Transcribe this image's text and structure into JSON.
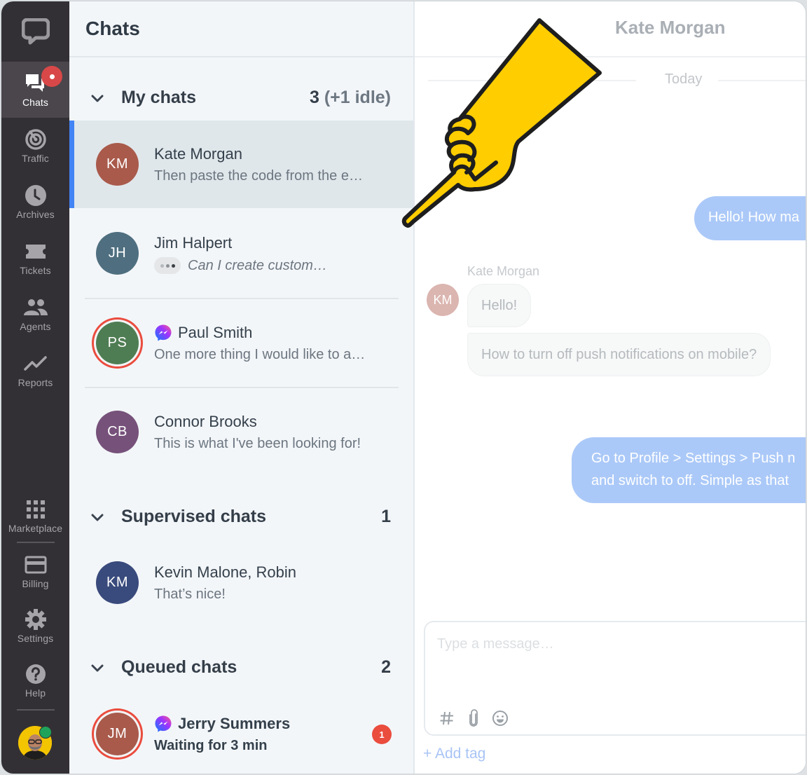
{
  "nav": {
    "logo_icon": "livechat-logo-icon",
    "items": [
      {
        "id": "chats",
        "label": "Chats",
        "icon": "chat-bubbles-icon",
        "active": true,
        "has_badge": true
      },
      {
        "id": "traffic",
        "label": "Traffic",
        "icon": "radar-icon"
      },
      {
        "id": "archives",
        "label": "Archives",
        "icon": "clock-icon"
      },
      {
        "id": "tickets",
        "label": "Tickets",
        "icon": "ticket-icon"
      },
      {
        "id": "agents",
        "label": "Agents",
        "icon": "people-icon"
      },
      {
        "id": "reports",
        "label": "Reports",
        "icon": "trend-line-icon"
      },
      {
        "id": "marketplace",
        "label": "Marketplace",
        "icon": "grid-icon"
      },
      {
        "id": "billing",
        "label": "Billing",
        "icon": "credit-card-icon"
      },
      {
        "id": "settings",
        "label": "Settings",
        "icon": "gear-icon"
      },
      {
        "id": "help",
        "label": "Help",
        "icon": "question-icon"
      }
    ],
    "user_status_color": "#1fa35b"
  },
  "chat_list": {
    "title": "Chats",
    "sections": [
      {
        "title": "My chats",
        "count": "3",
        "count_extra": "(+1 idle)",
        "chats": [
          {
            "initials": "KM",
            "name": "Kate Morgan",
            "preview": "Then paste the code from the e…",
            "avatar_color": "#a95a4b",
            "selected": true
          },
          {
            "initials": "JH",
            "name": "Jim Halpert",
            "preview": "Can I create custom…",
            "avatar_color": "#4f6f80",
            "typing": true
          },
          {
            "initials": "PS",
            "name": "Paul Smith",
            "preview": "One more thing I would like to a…",
            "avatar_color": "#4f7d53",
            "messenger": true,
            "ring": true
          },
          {
            "initials": "CB",
            "name": "Connor Brooks",
            "preview": "This is what I've been looking for!",
            "avatar_color": "#76517a"
          }
        ]
      },
      {
        "title": "Supervised chats",
        "count": "1",
        "chats": [
          {
            "initials": "KM",
            "name": "Kevin Malone, Robin",
            "preview": "That’s nice!",
            "avatar_color": "#394a7c"
          }
        ]
      },
      {
        "title": "Queued chats",
        "count": "2",
        "chats": [
          {
            "initials": "JM",
            "name": "Jerry Summers",
            "preview": "Waiting for 3 min",
            "avatar_color": "#a95a4b",
            "messenger": true,
            "ring": true,
            "unread": "1"
          }
        ]
      }
    ]
  },
  "conversation": {
    "title": "Kate Morgan",
    "date_separator": "Today",
    "messages": [
      {
        "direction": "out",
        "text": "Hello! How ma"
      },
      {
        "direction": "in",
        "sender": "Kate Morgan",
        "initials": "KM",
        "text": "Hello!"
      },
      {
        "direction": "in",
        "text": "How to turn off push notifications on mobile?"
      },
      {
        "direction": "out",
        "lines": [
          "Go to Profile > Settings > Push n",
          "and switch to off. Simple as that"
        ]
      }
    ],
    "composer": {
      "placeholder": "Type a message…",
      "tools": [
        "hashtag-icon",
        "paperclip-icon",
        "emoji-icon"
      ],
      "add_tag": "+ Add tag"
    }
  },
  "colors": {
    "accent": "#4384f5",
    "outgoing_bubble": "#abc9f8",
    "alert": "#ea4c3e",
    "nav_bg": "#333035",
    "hand_fill": "#ffcd00"
  }
}
